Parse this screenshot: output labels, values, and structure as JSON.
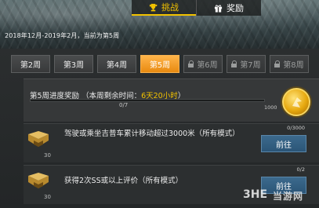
{
  "tabs": [
    {
      "label": "挑战",
      "icon": "trophy-icon",
      "active": true
    },
    {
      "label": "奖励",
      "icon": "gift-icon",
      "active": false
    }
  ],
  "season_label": "2018年12月-2019年2月，当前为第5周",
  "weeks": [
    {
      "label": "第2周",
      "locked": false,
      "active": false
    },
    {
      "label": "第3周",
      "locked": false,
      "active": false
    },
    {
      "label": "第4周",
      "locked": false,
      "active": false
    },
    {
      "label": "第5周",
      "locked": false,
      "active": true
    },
    {
      "label": "第6周",
      "locked": true,
      "active": false
    },
    {
      "label": "第7周",
      "locked": true,
      "active": false
    },
    {
      "label": "第8周",
      "locked": true,
      "active": false
    }
  ],
  "progress": {
    "title_prefix": "第5周进度奖励 （本周剩余时间：",
    "remaining": "6天20小时",
    "title_suffix": "）",
    "value_label": "0/7",
    "fraction": 0,
    "reward_count": "1000",
    "reward_icon": "coin-icon"
  },
  "tasks": [
    {
      "text": "驾驶或乘坐吉普车累计移动超过3000米（所有模式）",
      "count": "0/3000",
      "emblem_num": "30",
      "button": "前往"
    },
    {
      "text": "获得2次SS或以上评价（所有模式）",
      "count": "0/2",
      "emblem_num": "30",
      "button": "前往"
    }
  ],
  "watermark": {
    "logo": "3HE",
    "text": "当游网"
  },
  "colors": {
    "accent": "#f2c200",
    "active_week": "#f09a1e",
    "button": "#2f5b7e"
  }
}
